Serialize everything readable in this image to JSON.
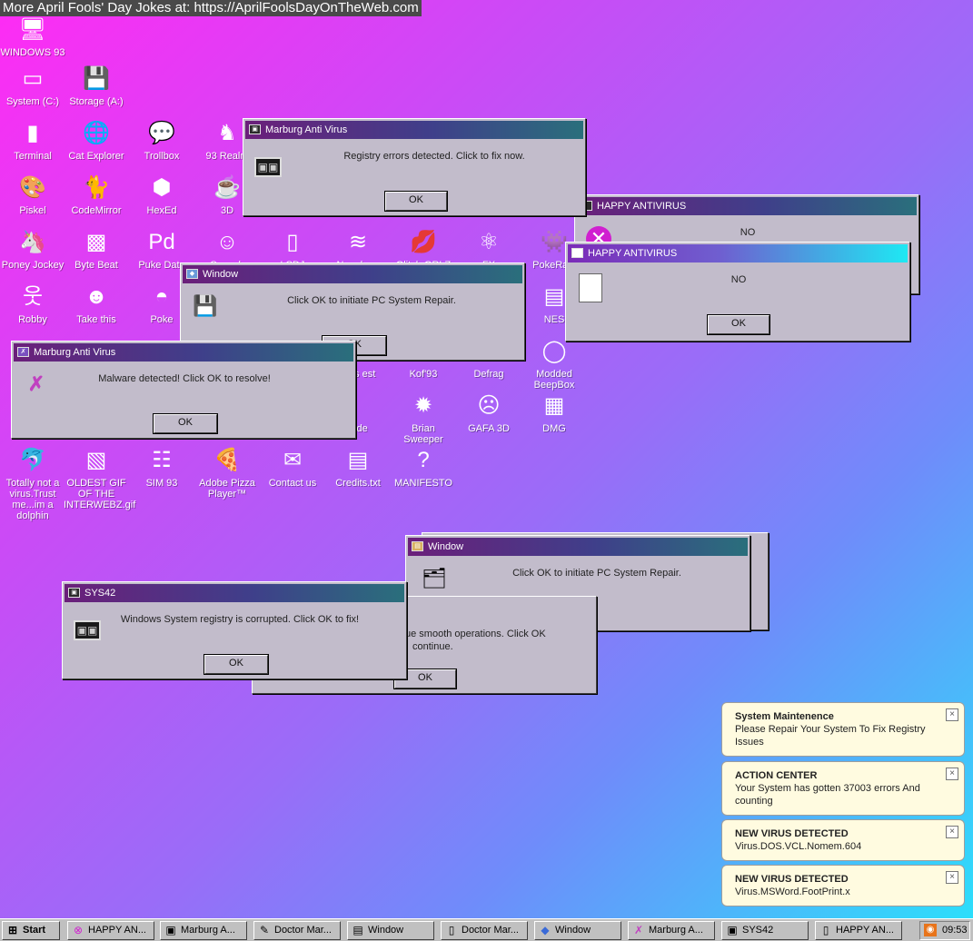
{
  "banner": "More April Fools' Day Jokes at: https://AprilFoolsDayOnTheWeb.com",
  "desktop_icons": [
    {
      "label": "WINDOWS 93",
      "icon": "computer-icon"
    },
    {
      "label": "System (C:)",
      "icon": "drive-icon"
    },
    {
      "label": "Storage (A:)",
      "icon": "floppy-drive-icon"
    },
    {
      "label": "Terminal",
      "icon": "terminal-icon"
    },
    {
      "label": "Cat Explorer",
      "icon": "globe-icon"
    },
    {
      "label": "Trollbox",
      "icon": "chat-icon"
    },
    {
      "label": "93 Realm",
      "icon": "realm-icon"
    },
    {
      "label": "Piskel",
      "icon": "palette-icon"
    },
    {
      "label": "CodeMirror",
      "icon": "cat-icon"
    },
    {
      "label": "HexEd",
      "icon": "hexagon-icon"
    },
    {
      "label": "3D",
      "icon": "teapot-icon"
    },
    {
      "label": "Poney Jockey",
      "icon": "pony-icon"
    },
    {
      "label": "Byte Beat",
      "icon": "bytebeat-icon"
    },
    {
      "label": "Puke Data",
      "icon": "pd-icon"
    },
    {
      "label": "Speech",
      "icon": "face-icon"
    },
    {
      "label": "LSDJ",
      "icon": "gameboy-icon"
    },
    {
      "label": "Nanoloop",
      "icon": "wave-icon"
    },
    {
      "label": "Glitch GRLZ",
      "icon": "lips-icon"
    },
    {
      "label": "FX",
      "icon": "atom-icon"
    },
    {
      "label": "PokeRain",
      "icon": "pokemon-icon"
    },
    {
      "label": "Robby",
      "icon": "stickman-icon"
    },
    {
      "label": "Take this",
      "icon": "character-icon"
    },
    {
      "label": "Poke",
      "icon": "pokeball-icon"
    },
    {
      "label": "NES",
      "icon": "nes-icon"
    },
    {
      "label": "ress est",
      "icon": "partial-icon"
    },
    {
      "label": "Kof'93",
      "icon": "fighter-icon"
    },
    {
      "label": "Defrag",
      "icon": "defrag-icon"
    },
    {
      "label": "Modded BeepBox",
      "icon": "ring-icon"
    },
    {
      "label": "tude",
      "icon": "partial-icon"
    },
    {
      "label": "Brian Sweeper",
      "icon": "mine-icon"
    },
    {
      "label": "GAFA 3D",
      "icon": "doom-face-icon"
    },
    {
      "label": "DMG",
      "icon": "console-icon"
    },
    {
      "label": "Totally not a virus.Trust me...im a dolphin",
      "icon": "dolphin-icon"
    },
    {
      "label": "OLDEST GIF OF THE INTERWEBZ.gif",
      "icon": "gif-icon"
    },
    {
      "label": "SIM 93",
      "icon": "sim-icon"
    },
    {
      "label": "Adobe Pizza Player™",
      "icon": "pizza-icon"
    },
    {
      "label": "Contact us",
      "icon": "mail-icon"
    },
    {
      "label": "Credits.txt",
      "icon": "text-file-icon"
    },
    {
      "label": "MANIFESTO",
      "icon": "question-mark-icon"
    }
  ],
  "windows": {
    "happy_back": {
      "title": "HAPPY ANTIVIRUS",
      "message": "NO"
    },
    "marburg_top": {
      "title": "Marburg Anti Virus",
      "message": "Registry errors detected. Click to fix now.",
      "ok": "OK"
    },
    "happy_front": {
      "title": "HAPPY ANTIVIRUS",
      "message": "NO",
      "ok": "OK"
    },
    "window_mid": {
      "title": "Window",
      "message": "Click OK to initiate PC System Repair.",
      "ok": "OK"
    },
    "marburg_left": {
      "title": "Marburg Anti Virus",
      "message": "Malware detected! Click OK to resolve!",
      "ok": "OK"
    },
    "window_low_back": {
      "title": "Window",
      "message": "Click OK to initiate PC System Repair."
    },
    "hidden_msg": {
      "line1": "ue smooth operations. Click OK",
      "line2": "continue.",
      "ok": "OK"
    },
    "sys42": {
      "title": "SYS42",
      "message": "Windows System registry is corrupted. Click OK to fix!",
      "ok": "OK"
    }
  },
  "notifications": [
    {
      "title": "System Maintenence",
      "body": "Please Repair Your System To Fix Registry Issues",
      "close": "×"
    },
    {
      "title": "ACTION CENTER",
      "body": "Your System has gotten 37003 errors And counting",
      "close": "×"
    },
    {
      "title": "NEW VIRUS DETECTED",
      "body": "Virus.DOS.VCL.Nomem.604",
      "close": "×"
    },
    {
      "title": "NEW VIRUS DETECTED",
      "body": "Virus.MSWord.FootPrint.x",
      "close": "×"
    }
  ],
  "taskbar": {
    "start": "Start",
    "tasks": [
      "HAPPY AN...",
      "Marburg A...",
      "Doctor Mar...",
      "Window",
      "Doctor Mar...",
      "Window",
      "Marburg A...",
      "SYS42",
      "HAPPY AN..."
    ],
    "clock": "09:53"
  },
  "colors": {
    "titlebar_start": "#6b1f7a",
    "titlebar_end": "#2a6f7c",
    "window_bg": "#c2bccb",
    "notif_bg": "#fffbe0"
  }
}
